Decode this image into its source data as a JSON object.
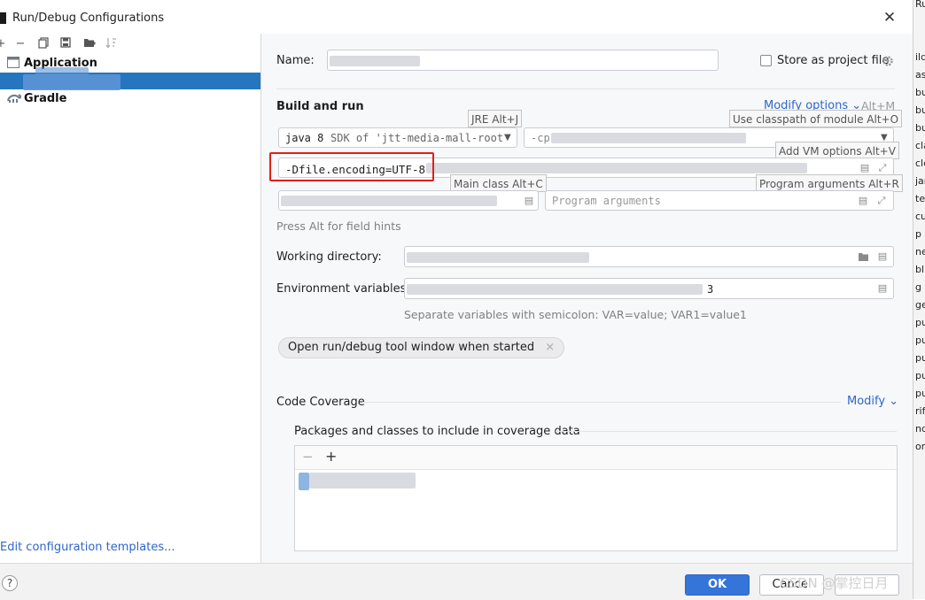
{
  "window": {
    "title": "Run/Debug Configurations",
    "close_glyph": "✕"
  },
  "behind_window": {
    "title": "Run Configu",
    "items": [
      "ild",
      "as",
      "bu",
      "bu",
      "bu",
      "cla",
      "cle",
      "jar",
      "tes",
      "cur",
      "p",
      "ner",
      "blis",
      "g",
      "ge",
      "pu",
      "pu",
      "pu",
      "pu",
      "pu",
      "rifi",
      "nde",
      "ont"
    ]
  },
  "toolbar": {
    "add": "+",
    "remove": "−",
    "copy": "⧉",
    "save": "💾",
    "folder": "📁",
    "sort": "↓a"
  },
  "tree": {
    "application_label": "Application",
    "gradle_label": "Gradle"
  },
  "edit_templates": "Edit configuration templates...",
  "form": {
    "name_label": "Name:",
    "store_project_file": "Store as project file",
    "build_and_run": "Build and run",
    "modify_options": "Modify options",
    "modify_options_shortcut": "Alt+M",
    "jre_tooltip": "JRE Alt+J",
    "classpath_tooltip": "Use classpath of module Alt+O",
    "jre_value": "java 8",
    "jre_sdk": "SDK of 'jtt-media-mall-root",
    "cp_prefix": "-cp",
    "vm_tooltip": "Add VM options Alt+V",
    "vm_value": "-Dfile.encoding=UTF-8",
    "main_class_tooltip": "Main class Alt+C",
    "program_args_tooltip": "Program arguments Alt+R",
    "program_args_placeholder": "Program arguments",
    "press_alt": "Press Alt for field hints",
    "working_dir_label": "Working directory:",
    "env_label": "Environment variables:",
    "env_suffix": "3",
    "env_hint": "Separate variables with semicolon: VAR=value; VAR1=value1",
    "open_tool_window_chip": "Open run/debug tool window when started",
    "chip_close": "×",
    "code_coverage": "Code Coverage",
    "modify": "Modify",
    "packages_label": "Packages and classes to include in coverage data",
    "list_remove": "−",
    "list_add": "+"
  },
  "buttons": {
    "ok": "OK",
    "cancel": "Cancel",
    "help": "?"
  },
  "watermark": "CSDN @掌控日月",
  "colors": {
    "accent": "#3574d8",
    "selection": "#2675bf",
    "highlight_box": "#e0201a",
    "link": "#2f65ca"
  }
}
